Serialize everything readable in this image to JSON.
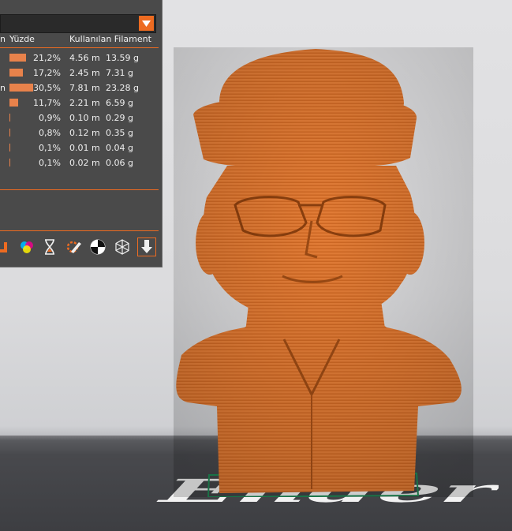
{
  "panel": {
    "headers": {
      "cut_label": "n",
      "percent": "Yüzde",
      "filament": "Kullanılan Filament"
    },
    "rows": [
      {
        "percent": "21,2%",
        "length": "4.56 m",
        "weight": "13.59 g",
        "fill": 0.212
      },
      {
        "percent": "17,2%",
        "length": "2.45 m",
        "weight": "7.31 g",
        "fill": 0.172
      },
      {
        "percent": "30,5%",
        "length": "7.81 m",
        "weight": "23.28 g",
        "fill": 0.305,
        "cut": "n"
      },
      {
        "percent": "11,7%",
        "length": "2.21 m",
        "weight": "6.59 g",
        "fill": 0.117
      },
      {
        "percent": "0,9%",
        "length": "0.10 m",
        "weight": "0.29 g",
        "fill": 0.009
      },
      {
        "percent": "0,8%",
        "length": "0.12 m",
        "weight": "0.35 g",
        "fill": 0.008
      },
      {
        "percent": "0,1%",
        "length": "0.01 m",
        "weight": "0.04 g",
        "fill": 0.001
      },
      {
        "percent": "0,1%",
        "length": "0.02 m",
        "weight": "0.06 g",
        "fill": 0.001
      }
    ],
    "toolbar": [
      "warning-icon",
      "color-palette-icon",
      "hourglass-icon",
      "pencil-edit-icon",
      "contrast-icon",
      "cube-wireframe-icon",
      "download-arrow-icon"
    ]
  },
  "viewport": {
    "bed_logo": "Ender",
    "model_color": "#e07b35",
    "accent": "#ed6b21"
  }
}
